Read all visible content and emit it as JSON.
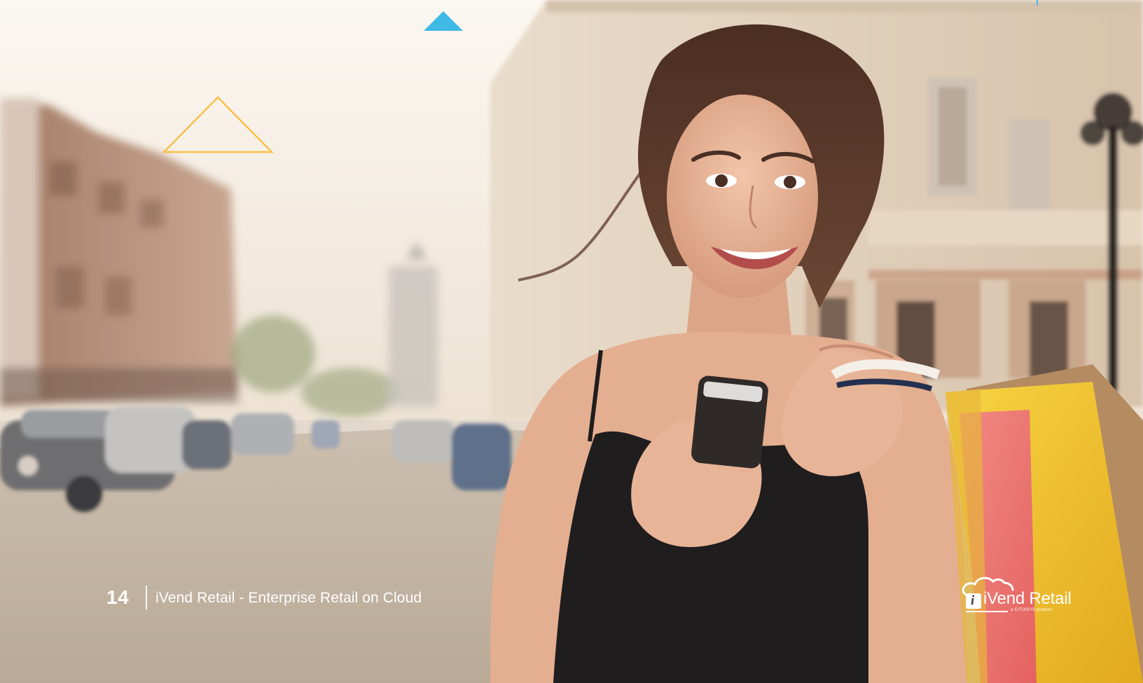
{
  "footer": {
    "page_number": "14",
    "document_title": "iVend Retail - Enterprise Retail on Cloud"
  },
  "logo": {
    "brand_name": "iVend Retail",
    "mark_letter": "i",
    "tagline": "a CITIXSYS product"
  },
  "colors": {
    "accent_blue": "#3fb9e6",
    "accent_yellow": "#f6c04a",
    "text_on_photo": "#ffffff"
  },
  "icons": {
    "decor_top": "triangle-filled-icon",
    "decor_left": "triangle-outline-icon",
    "logo": "cloud-icon"
  }
}
